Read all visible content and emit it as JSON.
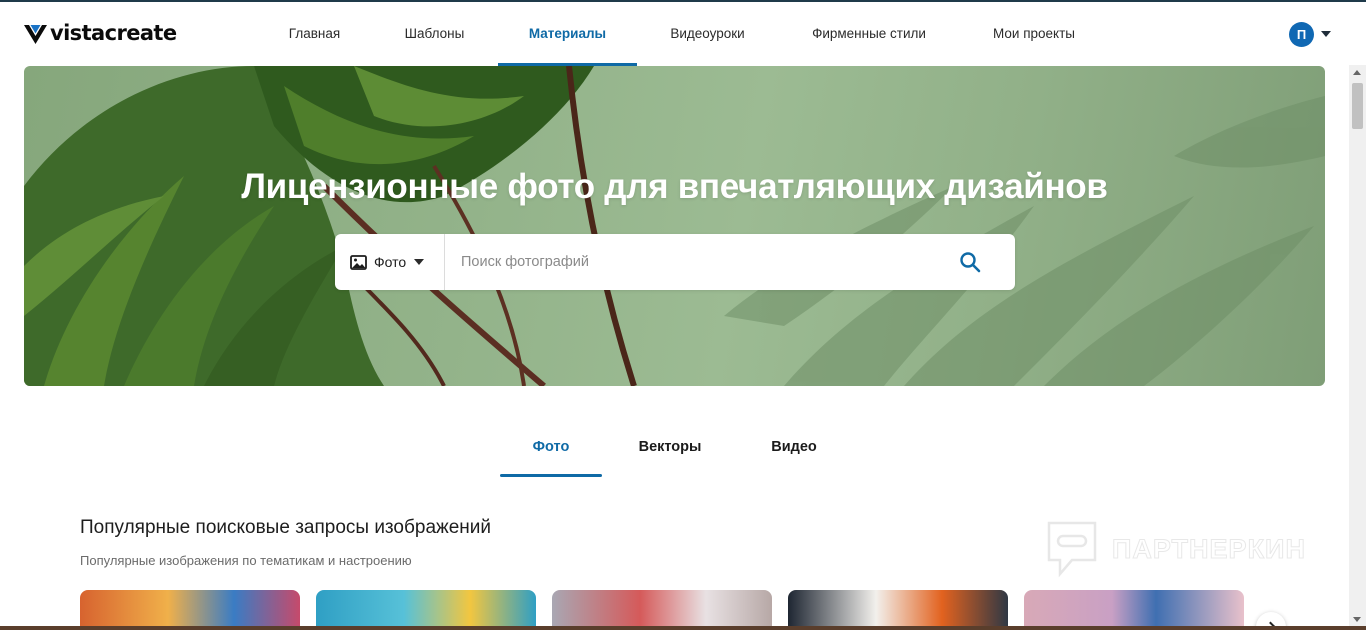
{
  "header": {
    "logo_text": "vistacreate",
    "nav": [
      {
        "label": "Главная",
        "active": false
      },
      {
        "label": "Шаблоны",
        "active": false
      },
      {
        "label": "Материалы",
        "active": true
      },
      {
        "label": "Видеоуроки",
        "active": false
      },
      {
        "label": "Фирменные стили",
        "active": false
      },
      {
        "label": "Мои проекты",
        "active": false
      }
    ],
    "avatar_letter": "П",
    "accent_color": "#0f6aa6"
  },
  "hero": {
    "title": "Лицензионные фото для впечатляющих дизайнов",
    "search_type_label": "Фото",
    "search_type_icon": "image-icon",
    "search_placeholder": "Поиск фотографий",
    "search_icon": "search-icon"
  },
  "tabs": [
    {
      "label": "Фото",
      "active": true
    },
    {
      "label": "Векторы",
      "active": false
    },
    {
      "label": "Видео",
      "active": false
    }
  ],
  "section": {
    "title": "Популярные поисковые запросы изображений",
    "subtitle": "Популярные изображения по тематикам и настроению"
  },
  "watermark": "ПАРТНЕРКИН",
  "cards": [
    {
      "color": "#c8753a"
    },
    {
      "color": "#3aa3c2"
    },
    {
      "color": "#b7a8a6"
    },
    {
      "color": "#2f3844"
    },
    {
      "color": "#d8a9b7"
    }
  ]
}
